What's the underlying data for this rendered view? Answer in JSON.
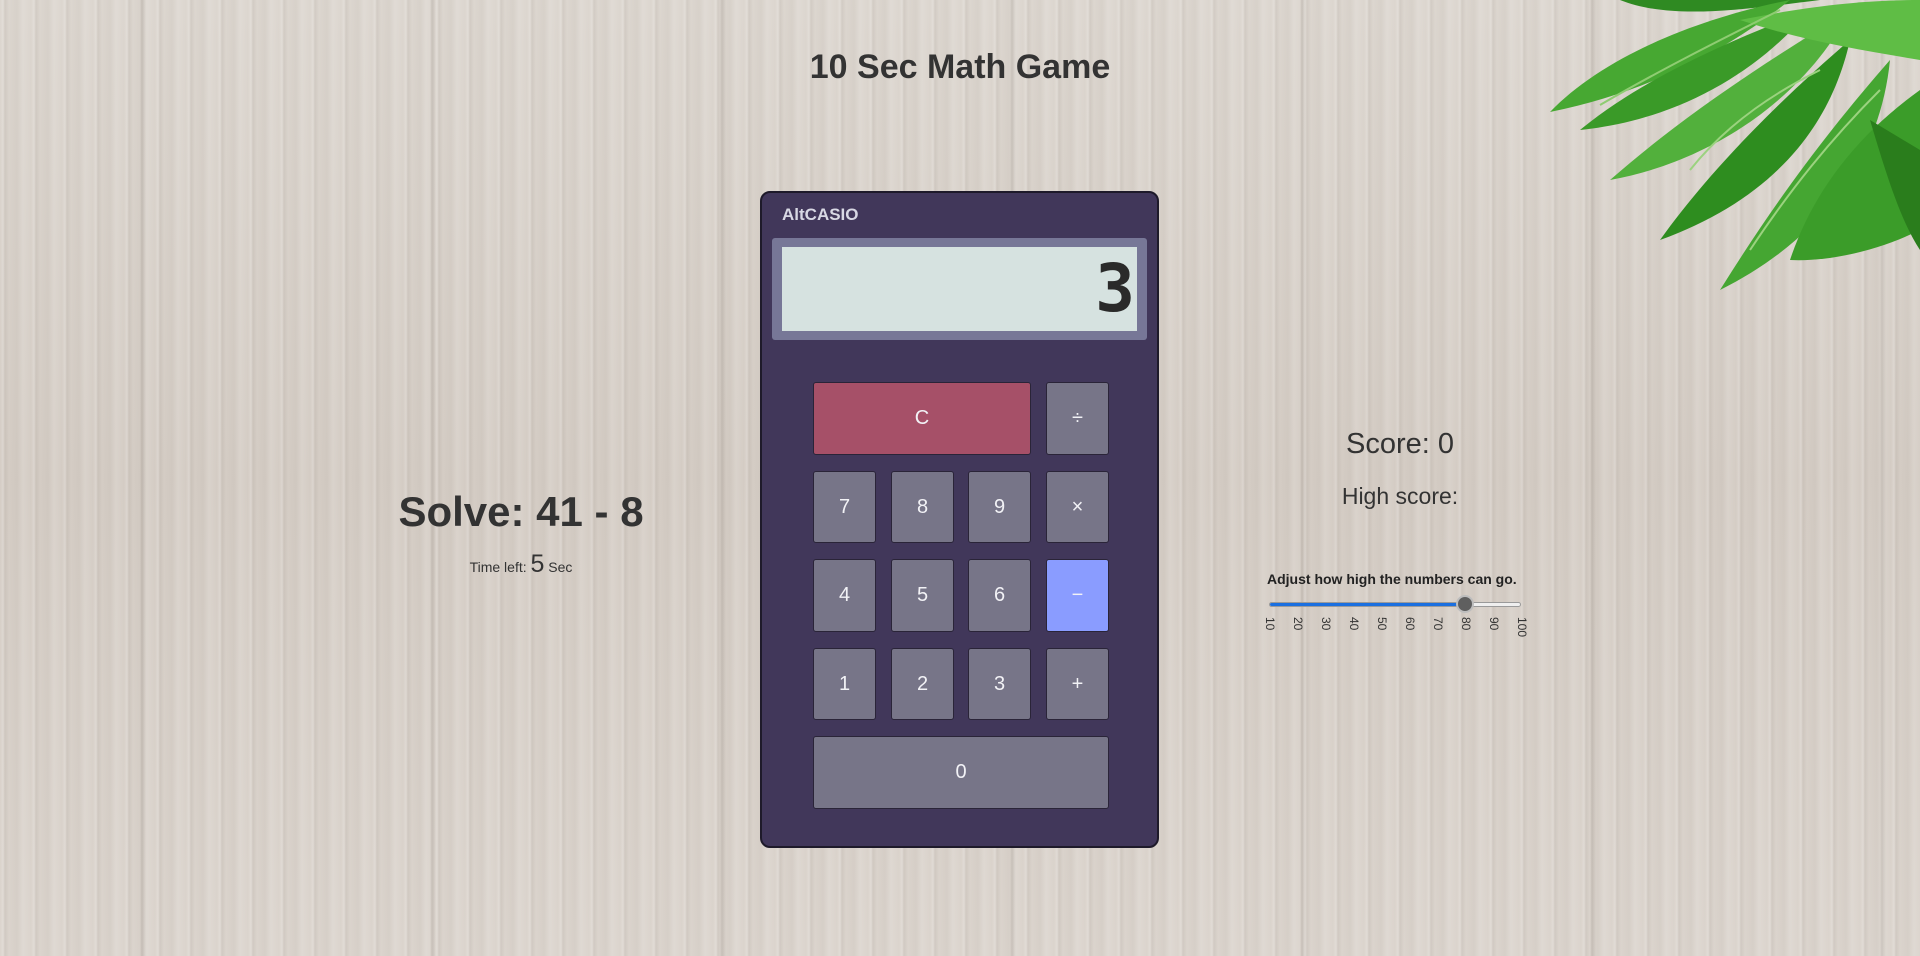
{
  "page": {
    "title": "10 Sec Math Game"
  },
  "problem": {
    "text": "Solve: 41 - 8",
    "time_prefix": "Time left:",
    "time_value": "5",
    "time_unit": "Sec"
  },
  "calculator": {
    "brand": "AltCASIO",
    "display_value": "3",
    "keys": {
      "clear": "C",
      "divide": "÷",
      "seven": "7",
      "eight": "8",
      "nine": "9",
      "multiply": "×",
      "four": "4",
      "five": "5",
      "six": "6",
      "subtract": "−",
      "one": "1",
      "two": "2",
      "three": "3",
      "add": "+",
      "zero": "0"
    },
    "colors": {
      "body": "#41375a",
      "key": "#777588",
      "clear_key": "#a65068",
      "active_operator": "#8a9cff",
      "display_bg": "#d6e2e0"
    }
  },
  "score": {
    "score_text": "Score: 0",
    "high_score_text": "High score:"
  },
  "range_slider": {
    "label": "Adjust how high the numbers can go.",
    "min": 10,
    "max": 100,
    "value": 80,
    "ticks": [
      "10",
      "20",
      "30",
      "40",
      "50",
      "60",
      "70",
      "80",
      "90",
      "100"
    ],
    "fill_color": "#1a6fe0"
  }
}
